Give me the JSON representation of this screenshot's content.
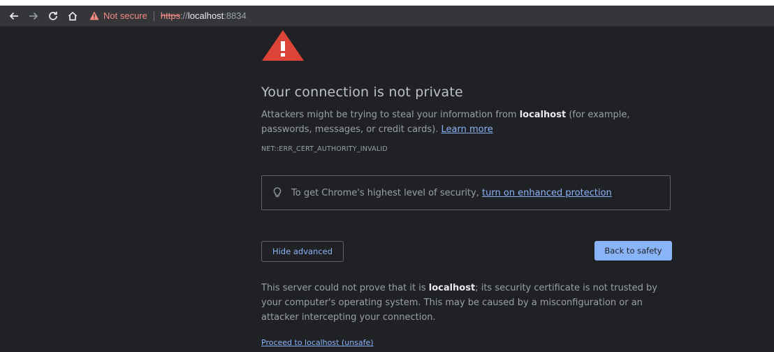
{
  "browser": {
    "nav": {
      "back_icon": "arrow-left-icon",
      "forward_icon": "arrow-right-icon",
      "reload_icon": "reload-icon",
      "home_icon": "home-icon"
    },
    "omnibox": {
      "security_label": "Not secure",
      "scheme": "https",
      "separator": "://",
      "host": "localhost",
      "port": ":8834"
    }
  },
  "interstitial": {
    "title": "Your connection is not private",
    "description": {
      "before_host": "Attackers might be trying to steal your information from ",
      "host": "localhost",
      "after_host": " (for example, passwords, messages, or credit cards). ",
      "learn_more": "Learn more"
    },
    "error_code": "NET::ERR_CERT_AUTHORITY_INVALID",
    "enhanced_protection": {
      "text": "To get Chrome's highest level of security, ",
      "link": "turn on enhanced protection"
    },
    "buttons": {
      "hide_advanced": "Hide advanced",
      "back_to_safety": "Back to safety"
    },
    "detail": {
      "before_host": "This server could not prove that it is ",
      "host": "localhost",
      "after_host": "; its security certificate is not trusted by your computer's operating system. This may be caused by a misconfiguration or an attacker intercepting your connection."
    },
    "proceed_link": "Proceed to localhost (unsafe)"
  },
  "colors": {
    "background": "#202124",
    "warning_red": "#db4437",
    "link_blue": "#8ab4f8",
    "insecure_red": "#f28b82"
  }
}
